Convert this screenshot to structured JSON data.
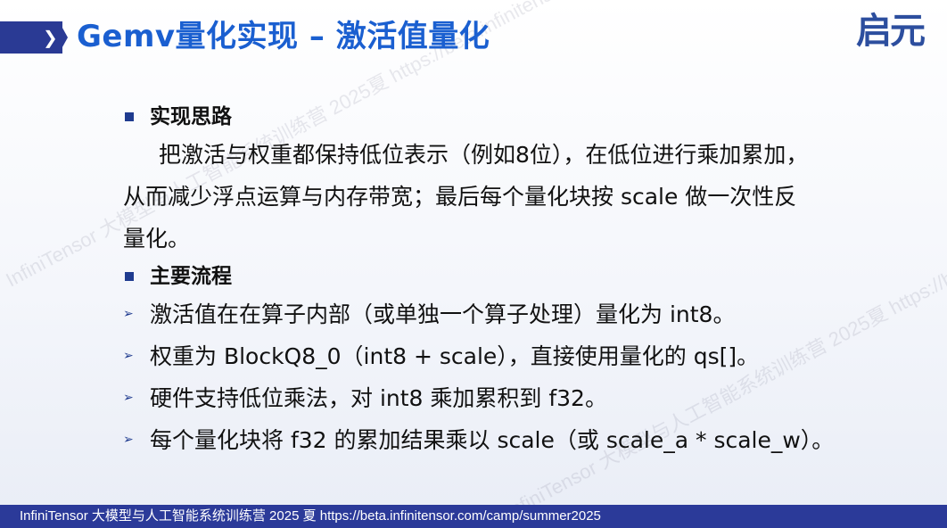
{
  "header": {
    "title": "Gemv量化实现 – 激活值量化",
    "chevron": "❯",
    "logo_text": "启元"
  },
  "sections": [
    {
      "title": "实现思路",
      "paragraph_line1": "把激活与权重都保持低位表示（例如8位），在低位进行乘加累加，",
      "paragraph_line2": "从而减少浮点运算与内存带宽；最后每个量化块按 scale 做一次性反",
      "paragraph_line3": "量化。"
    },
    {
      "title": "主要流程",
      "bullets": [
        "激活值在在算子内部（或单独一个算子处理）量化为 int8。",
        "权重为 BlockQ8_0（int8 + scale），直接使用量化的 qs[]。",
        "硬件支持低位乘法，对 int8 乘加累积到 f32。",
        "每个量化块将 f32 的累加结果乘以 scale（或 scale_a * scale_w）。"
      ]
    }
  ],
  "bullet_marker": "➢",
  "footer": {
    "text": "InfiniTensor 大模型与人工智能系统训练营 2025 夏    https://beta.infinitensor.com/camp/summer2025"
  },
  "watermark": {
    "text": "InfiniTensor 大模型与人工智能系统训练营 2025夏 https://beta.infinitensor.com/camp/summer2025"
  },
  "colors": {
    "title": "#1a5fd0",
    "accent": "#2a3a94",
    "footer_bg": "#2b3a99",
    "logo": "#2c4e9e"
  }
}
